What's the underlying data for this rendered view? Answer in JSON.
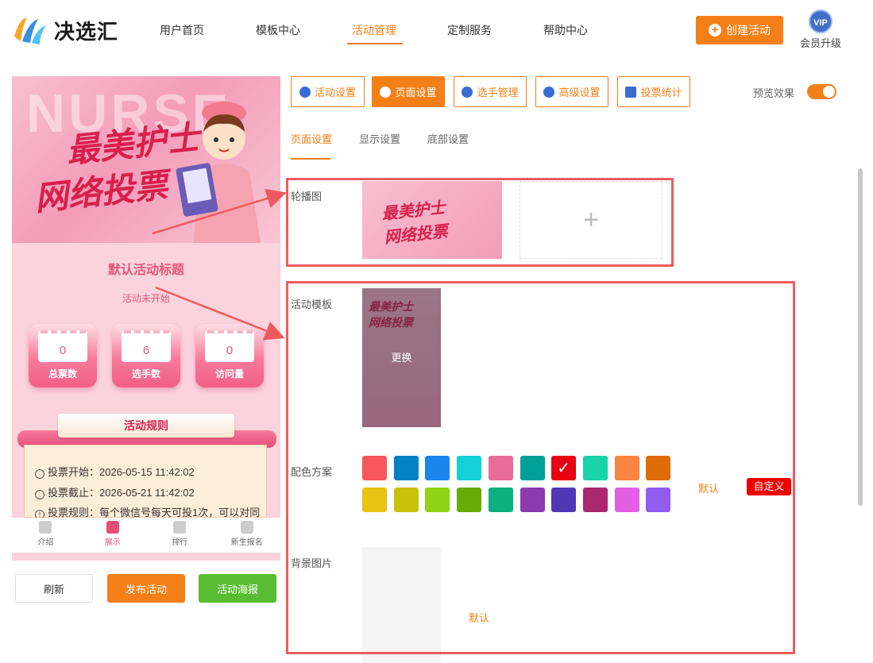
{
  "header": {
    "brand": "决选汇",
    "nav": [
      "用户首页",
      "模板中心",
      "活动管理",
      "定制服务",
      "帮助中心"
    ],
    "active_nav": "活动管理",
    "create_label": "创建活动",
    "vip_badge": "VIP",
    "vip_label": "会员升级"
  },
  "preview": {
    "banner_bg_word": "NURSE",
    "banner_line1": "最美护士",
    "banner_line2": "网络投票",
    "title": "默认活动标题",
    "status": "活动未开始",
    "stats": [
      {
        "value": "0",
        "label": "总票数"
      },
      {
        "value": "6",
        "label": "选手数"
      },
      {
        "value": "0",
        "label": "访问量"
      }
    ],
    "rules_title": "活动规则",
    "rules": [
      "投票开始：2026-05-15 11:42:02",
      "投票截止：2026-05-21 11:42:02",
      "投票规则：每个微信号每天可投1次，可以对同"
    ],
    "tabs": [
      "介绍",
      "展示",
      "排行",
      "新生报名"
    ],
    "active_tab": "展示",
    "buttons": {
      "refresh": "刷新",
      "publish": "发布活动",
      "poster": "活动海报"
    }
  },
  "settings": {
    "tabs": [
      "活动设置",
      "页面设置",
      "选手管理",
      "高级设置",
      "投票统计"
    ],
    "active_tab": "页面设置",
    "preview_label": "预览效果",
    "preview_on": true,
    "subtabs": [
      "页面设置",
      "显示设置",
      "底部设置"
    ],
    "active_subtab": "页面设置",
    "carousel_label": "轮播图",
    "template_label": "活动模板",
    "template_change": "更换",
    "color_label": "配色方案",
    "colors_row1": [
      "#f5575c",
      "#0382c2",
      "#1a86ec",
      "#13d1d6",
      "#e96b99",
      "#01a096",
      "#e60012",
      "#18d4a8",
      "#fc8442",
      "#df6b06"
    ],
    "colors_row2": [
      "#e9c212",
      "#c7c10a",
      "#8fd413",
      "#65ac06",
      "#0cb07e",
      "#8c3ab0",
      "#5038b4",
      "#a9286f",
      "#e35ee3",
      "#925cf1"
    ],
    "selected_color": "#e60012",
    "color_default": "默认",
    "color_custom": "自定义",
    "bg_label": "背景图片",
    "bg_default": "默认"
  }
}
